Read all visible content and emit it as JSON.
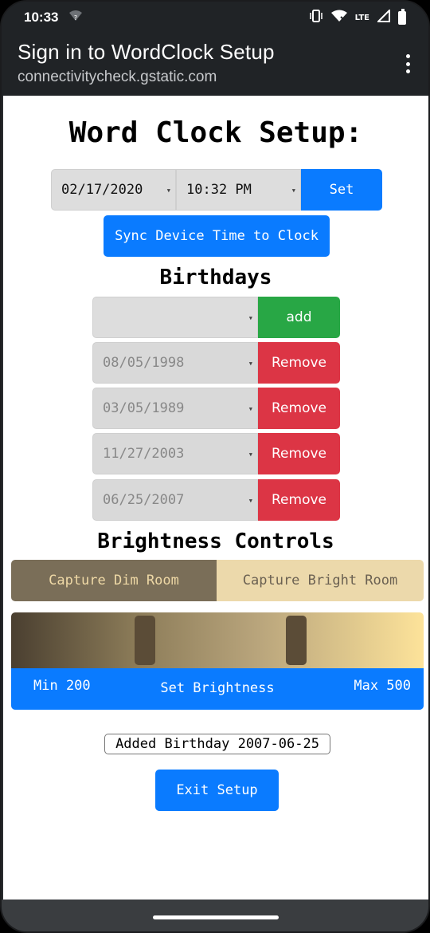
{
  "status_bar": {
    "time": "10:33",
    "network_label": "LTE"
  },
  "app_bar": {
    "title": "Sign in to WordClock Setup",
    "url": "connectivitycheck.gstatic.com"
  },
  "page": {
    "title": "Word Clock Setup:",
    "date_value": "02/17/2020",
    "time_value": "10:32 PM",
    "set_label": "Set",
    "sync_label": "Sync Device Time to Clock"
  },
  "birthdays": {
    "title": "Birthdays",
    "new_value": "",
    "add_label": "add",
    "remove_label": "Remove",
    "items": [
      "08/05/1998",
      "03/05/1989",
      "11/27/2003",
      "06/25/2007"
    ]
  },
  "brightness": {
    "title": "Brightness Controls",
    "capture_dim_label": "Capture Dim Room",
    "capture_bright_label": "Capture Bright Room",
    "min_label": "Min 200",
    "set_label": "Set Brightness",
    "max_label": "Max 500",
    "min_value": 200,
    "max_value": 500,
    "range_min": 0,
    "range_max": 1023
  },
  "message": "Added Birthday 2007-06-25",
  "exit_label": "Exit Setup",
  "colors": {
    "primary": "#0a7bff",
    "success": "#28a745",
    "danger": "#dc3545"
  }
}
